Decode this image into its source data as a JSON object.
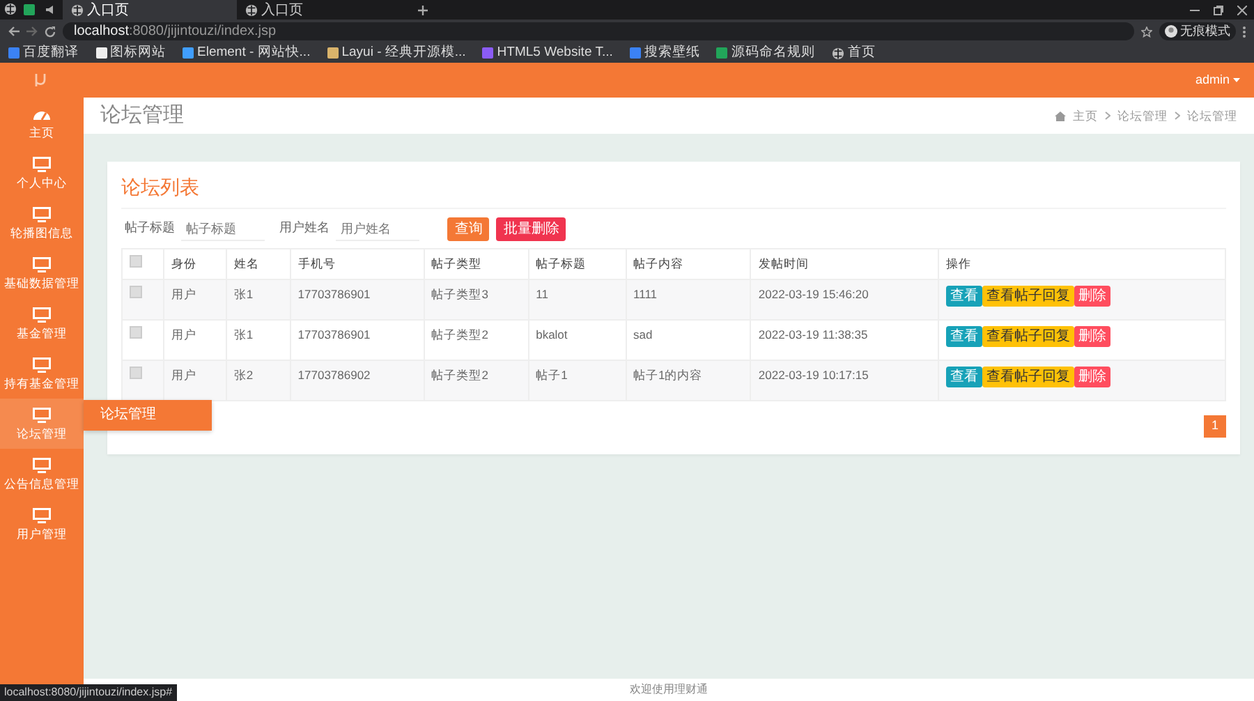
{
  "browser": {
    "tabs": [
      {
        "title": "入口页",
        "selected": true
      },
      {
        "title": "入口页",
        "selected": false
      }
    ],
    "address": {
      "host": "localhost",
      "path": ":8080/jijintouzi/index.jsp"
    },
    "profile": "无痕模式",
    "bookmarks": [
      {
        "label": "百度翻译",
        "kind": "blue"
      },
      {
        "label": "图标网站",
        "kind": "dark"
      },
      {
        "label": "Element - 网站快...",
        "kind": "element"
      },
      {
        "label": "Layui - 经典开源模...",
        "kind": "layui"
      },
      {
        "label": "HTML5 Website T...",
        "kind": "purple"
      },
      {
        "label": "搜索壁纸",
        "kind": "blue"
      },
      {
        "label": "源码命名规则",
        "kind": "green"
      },
      {
        "label": "首页",
        "kind": "globe"
      }
    ],
    "status_link": "localhost:8080/jijintouzi/index.jsp#"
  },
  "topbar": {
    "user": "admin"
  },
  "sidebar": {
    "items": [
      {
        "label": "主页",
        "kind": "dashboard",
        "hovered": false
      },
      {
        "label": "个人中心",
        "kind": "monitor",
        "hovered": false
      },
      {
        "label": "轮播图信息",
        "kind": "monitor",
        "hovered": false
      },
      {
        "label": "基础数据管理",
        "kind": "monitor",
        "hovered": false
      },
      {
        "label": "基金管理",
        "kind": "monitor",
        "hovered": false
      },
      {
        "label": "持有基金管理",
        "kind": "monitor",
        "hovered": false
      },
      {
        "label": "论坛管理",
        "kind": "monitor",
        "hovered": true,
        "submenu": [
          "论坛管理"
        ]
      },
      {
        "label": "公告信息管理",
        "kind": "monitor",
        "hovered": false
      },
      {
        "label": "用户管理",
        "kind": "monitor",
        "hovered": false
      }
    ]
  },
  "page": {
    "title": "论坛管理",
    "breadcrumb": [
      "主页",
      "论坛管理",
      "论坛管理"
    ]
  },
  "card": {
    "title": "论坛列表",
    "filters": [
      {
        "label": "帖子标题",
        "placeholder": "帖子标题"
      },
      {
        "label": "用户姓名",
        "placeholder": "用户姓名"
      }
    ],
    "buttons": [
      {
        "label": "查询",
        "kind": "search"
      },
      {
        "label": "批量删除",
        "kind": "danger"
      }
    ],
    "table": {
      "select_all_checked": false,
      "columns": [
        "身份",
        "姓名",
        "手机号",
        "帖子类型",
        "帖子标题",
        "帖子内容",
        "发帖时间",
        "操作"
      ],
      "rows": [
        {
          "checked": false,
          "cells": [
            "用户",
            "张1",
            "17703786901",
            "帖子类型3",
            "11",
            "1111",
            "2022-03-19 15:46:20"
          ],
          "actions": [
            {
              "label": "查看",
              "kind": "info"
            },
            {
              "label": "查看帖子回复",
              "kind": "warning"
            },
            {
              "label": "删除",
              "kind": "danger"
            }
          ]
        },
        {
          "checked": false,
          "cells": [
            "用户",
            "张1",
            "17703786901",
            "帖子类型2",
            "bkalot",
            "sad",
            "2022-03-19 11:38:35"
          ],
          "actions": [
            {
              "label": "查看",
              "kind": "info"
            },
            {
              "label": "查看帖子回复",
              "kind": "warning"
            },
            {
              "label": "删除",
              "kind": "danger"
            }
          ]
        },
        {
          "checked": false,
          "cells": [
            "用户",
            "张2",
            "17703786902",
            "帖子类型2",
            "帖子1",
            "帖子1的内容",
            "2022-03-19 10:17:15"
          ],
          "actions": [
            {
              "label": "查看",
              "kind": "info"
            },
            {
              "label": "查看帖子回复",
              "kind": "warning"
            },
            {
              "label": "删除",
              "kind": "danger"
            }
          ]
        }
      ]
    },
    "pagination": [
      {
        "label": "1",
        "selected": true
      }
    ]
  },
  "footer": "欢迎使用理财通"
}
